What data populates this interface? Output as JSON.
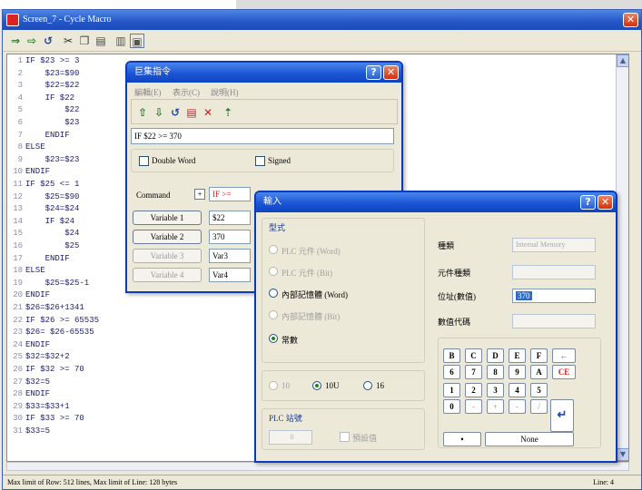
{
  "main_window": {
    "title": "Screen_7 - Cycle Macro",
    "status_left": "Max limit of Row: 512 lines, Max limit of Line: 128 bytes",
    "status_right": "Line: 4",
    "close_glyph": "✕"
  },
  "code_lines": [
    {
      "n": "1",
      "t": "IF $23 >= 3"
    },
    {
      "n": "2",
      "t": "    $23=$90"
    },
    {
      "n": "3",
      "t": "    $22=$22"
    },
    {
      "n": "4",
      "t": "    IF $22 "
    },
    {
      "n": "5",
      "t": "        $22"
    },
    {
      "n": "6",
      "t": "        $23"
    },
    {
      "n": "7",
      "t": "    ENDIF"
    },
    {
      "n": "8",
      "t": "ELSE"
    },
    {
      "n": "9",
      "t": "    $23=$23"
    },
    {
      "n": "10",
      "t": "ENDIF"
    },
    {
      "n": "11",
      "t": "IF $25 <= 1"
    },
    {
      "n": "12",
      "t": "    $25=$90"
    },
    {
      "n": "13",
      "t": "    $24=$24"
    },
    {
      "n": "14",
      "t": "    IF $24 "
    },
    {
      "n": "15",
      "t": "        $24"
    },
    {
      "n": "16",
      "t": "        $25"
    },
    {
      "n": "17",
      "t": "    ENDIF"
    },
    {
      "n": "18",
      "t": "ELSE"
    },
    {
      "n": "19",
      "t": "    $25=$25-1"
    },
    {
      "n": "20",
      "t": "ENDIF"
    },
    {
      "n": "21",
      "t": "$26=$26+1341"
    },
    {
      "n": "22",
      "t": "IF $26 >= 65535"
    },
    {
      "n": "23",
      "t": "$26= $26-65535"
    },
    {
      "n": "24",
      "t": "ENDIF"
    },
    {
      "n": "25",
      "t": "$32=$32+2"
    },
    {
      "n": "26",
      "t": "IF $32 >= 70"
    },
    {
      "n": "27",
      "t": "$32=5"
    },
    {
      "n": "28",
      "t": "ENDIF"
    },
    {
      "n": "29",
      "t": "$33=$33+1"
    },
    {
      "n": "30",
      "t": "IF $33 >= 70"
    },
    {
      "n": "31",
      "t": "$33=5"
    }
  ],
  "cmd_dialog": {
    "title": "巨集指令",
    "help": "?",
    "close": "✕",
    "menus": [
      "編輯(E)",
      "表示(C)",
      "說明(H)"
    ],
    "expression": "IF $22 >= 370",
    "double_word": "Double Word",
    "signed": "Signed",
    "command_label": "Command",
    "command_value": "IF >=",
    "variables": [
      {
        "label": "Variable 1",
        "value": "$22",
        "enabled": true
      },
      {
        "label": "Variable 2",
        "value": "370",
        "enabled": true
      },
      {
        "label": "Variable 3",
        "value": "Var3",
        "enabled": false
      },
      {
        "label": "Variable 4",
        "value": "Var4",
        "enabled": false
      }
    ]
  },
  "input_dialog": {
    "title": "輸入",
    "help": "?",
    "close": "✕",
    "type_group": "型式",
    "types": [
      {
        "label": "PLC 元件 (Word)",
        "enabled": false,
        "selected": false
      },
      {
        "label": "PLC 元件 (Bit)",
        "enabled": false,
        "selected": false
      },
      {
        "label": "內部記憶體 (Word)",
        "enabled": true,
        "selected": false
      },
      {
        "label": "內部記憶體 (Bit)",
        "enabled": false,
        "selected": false
      },
      {
        "label": "常數",
        "enabled": true,
        "selected": true
      }
    ],
    "bases": [
      {
        "label": "10",
        "enabled": false,
        "selected": false
      },
      {
        "label": "10U",
        "enabled": true,
        "selected": true
      },
      {
        "label": "16",
        "enabled": true,
        "selected": false
      }
    ],
    "plc_station_label": "PLC 站號",
    "station_value": "0",
    "broadcast_label": "預設值",
    "fields": [
      {
        "label": "種類",
        "value": "Internal Memory",
        "enabled": false
      },
      {
        "label": "元件種類",
        "value": "",
        "enabled": false
      },
      {
        "label": "位址(數值)",
        "value": "370",
        "enabled": true
      },
      {
        "label": "數值代碼",
        "value": "",
        "enabled": false
      }
    ],
    "keys": [
      [
        "B",
        "C",
        "D",
        "E",
        "F",
        "←"
      ],
      [
        "6",
        "7",
        "8",
        "9",
        "A",
        "CE"
      ],
      [
        "1",
        "2",
        "3",
        "4",
        "5",
        ""
      ],
      [
        "0",
        "-",
        "+",
        "-",
        "/",
        ""
      ]
    ],
    "dot_key": "•",
    "none_key": "None",
    "enter_glyph": "↵"
  }
}
